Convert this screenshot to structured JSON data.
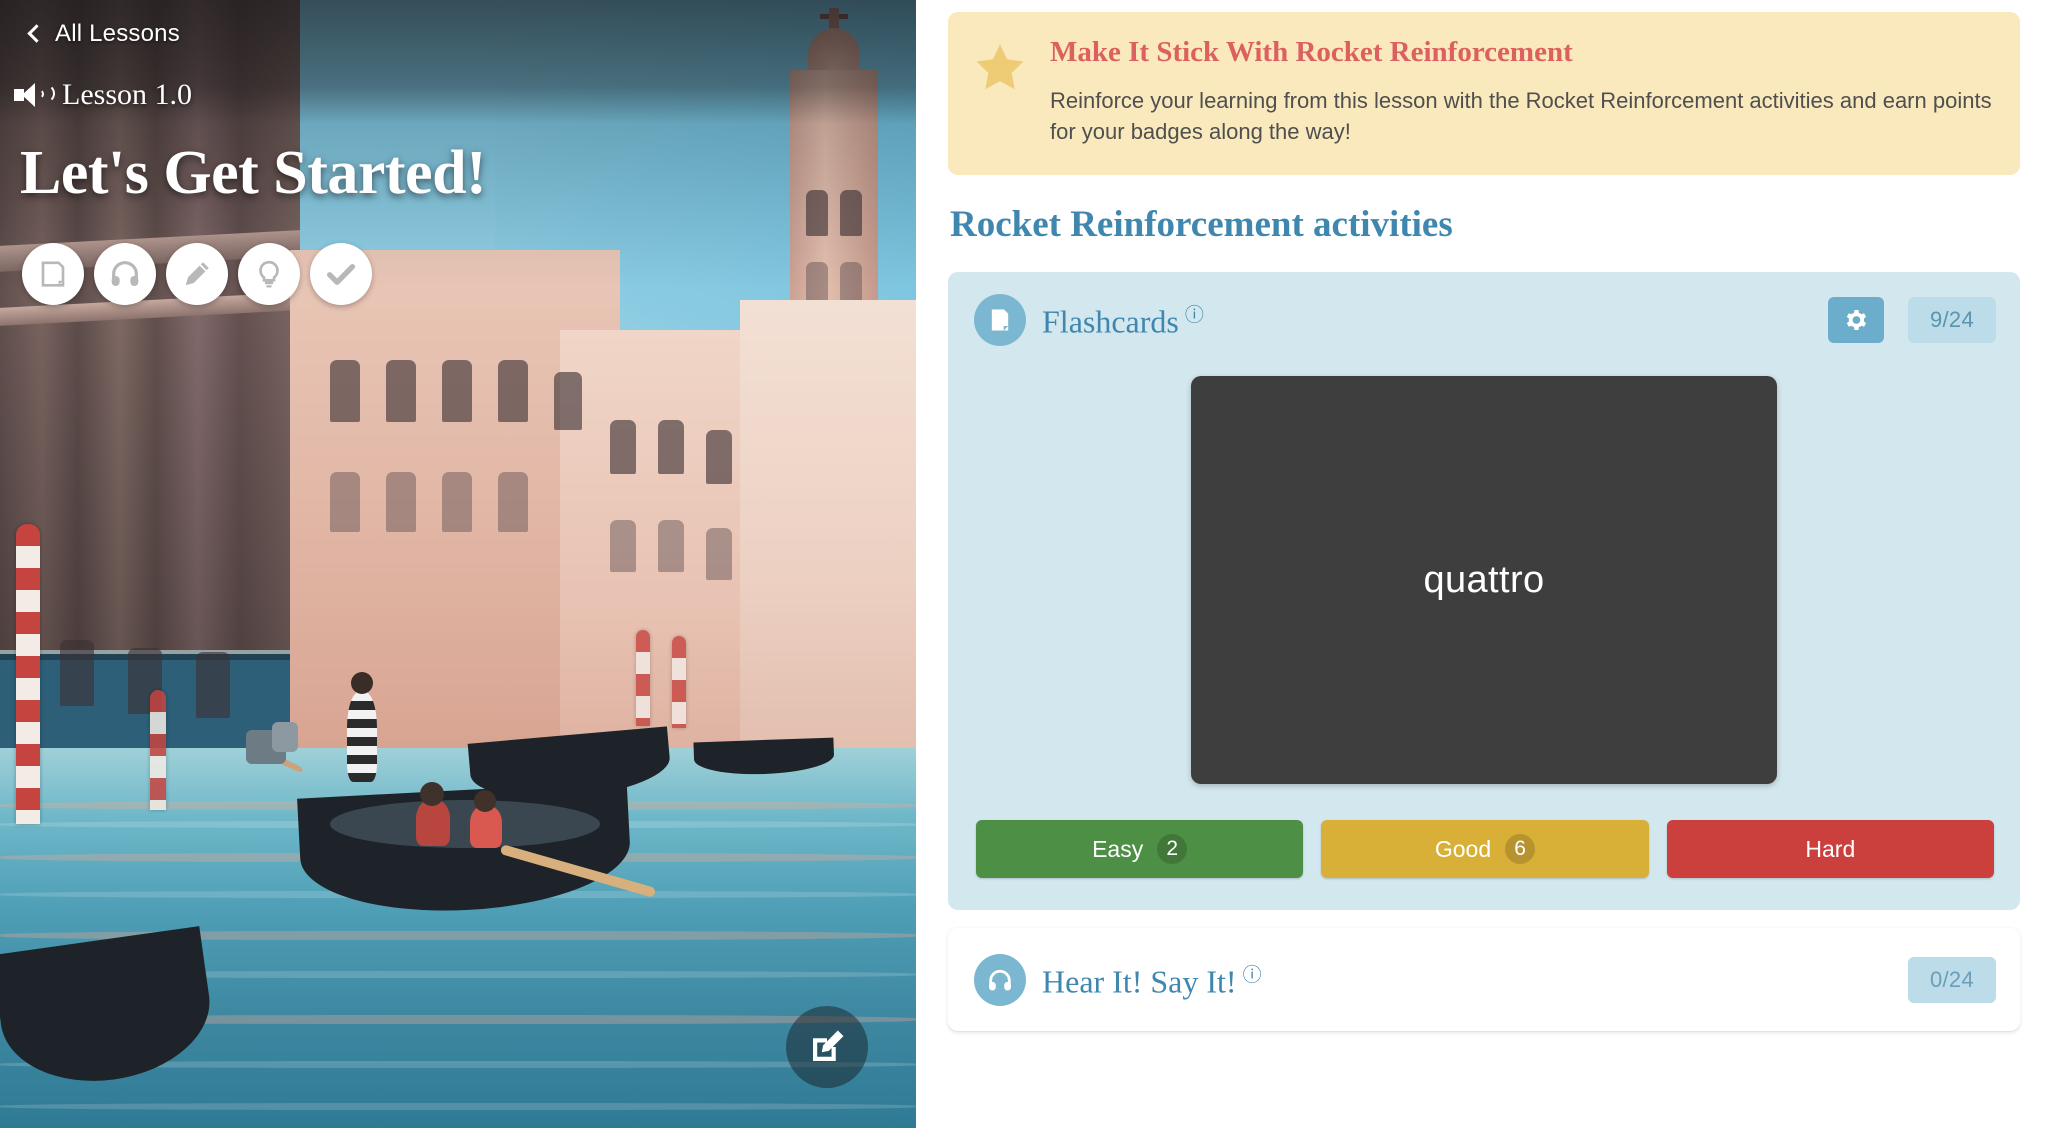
{
  "hero": {
    "back_link": "All Lessons",
    "lesson_label": "Lesson 1.0",
    "title": "Let's Get Started!",
    "icons": [
      {
        "name": "flashcard-icon",
        "label": "Flashcards"
      },
      {
        "name": "headphones-icon",
        "label": "Hear It! Say It!"
      },
      {
        "name": "pencil-icon",
        "label": "Write It!"
      },
      {
        "name": "lightbulb-icon",
        "label": "Know It!"
      },
      {
        "name": "check-icon",
        "label": "Mark Complete"
      }
    ],
    "compose_button": "compose-icon"
  },
  "banner": {
    "icon": "star-icon",
    "title": "Make It Stick With Rocket Reinforcement",
    "body": "Reinforce your learning from this lesson with the Rocket Reinforcement activities and earn points for your badges along the way!",
    "bg_color": "#fae9bc",
    "title_color": "#dc6060",
    "star_color": "#edcc75"
  },
  "section": {
    "title": "Rocket Reinforcement activities",
    "title_color": "#3f87ae"
  },
  "flashcards": {
    "icon": "flashcard-icon",
    "title": "Flashcards",
    "help": "?",
    "settings_icon": "gear-icon",
    "counter": "9/24",
    "card_text": "quattro",
    "card_bg": "#3e3e3e",
    "panel_bg": "#d3e7ef",
    "grades": [
      {
        "label": "Easy",
        "count": "2",
        "color": "#4e8f46"
      },
      {
        "label": "Good",
        "count": "6",
        "color": "#d9b037"
      },
      {
        "label": "Hard",
        "count": "",
        "color": "#cb3f3c"
      }
    ]
  },
  "hear_say": {
    "icon": "headphones-icon",
    "title": "Hear It! Say It!",
    "help": "?",
    "counter": "0/24"
  }
}
